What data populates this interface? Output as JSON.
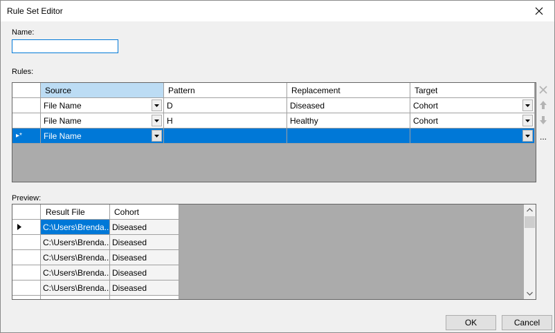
{
  "window": {
    "title": "Rule Set Editor"
  },
  "name": {
    "label": "Name:",
    "value": ""
  },
  "rules": {
    "label": "Rules:",
    "columns": [
      "Source",
      "Pattern",
      "Replacement",
      "Target"
    ],
    "rows": [
      {
        "source": "File Name",
        "pattern": "D",
        "replacement": "Diseased",
        "target": "Cohort"
      },
      {
        "source": "File Name",
        "pattern": "H",
        "replacement": "Healthy",
        "target": "Cohort"
      },
      {
        "source": "File Name",
        "pattern": "",
        "replacement": "",
        "target": "",
        "row_header": "▸*"
      }
    ],
    "side_buttons": {
      "more_label": "..."
    }
  },
  "preview": {
    "label": "Preview:",
    "columns": [
      "Result File",
      "Cohort"
    ],
    "rows": [
      {
        "file": "C:\\Users\\Brenda...",
        "cohort": "Diseased"
      },
      {
        "file": "C:\\Users\\Brenda...",
        "cohort": "Diseased"
      },
      {
        "file": "C:\\Users\\Brenda...",
        "cohort": "Diseased"
      },
      {
        "file": "C:\\Users\\Brenda...",
        "cohort": "Diseased"
      },
      {
        "file": "C:\\Users\\Brenda...",
        "cohort": "Diseased"
      }
    ]
  },
  "buttons": {
    "ok": "OK",
    "cancel": "Cancel"
  },
  "colors": {
    "selection": "#0078d7",
    "header_selected": "#bcdcf4",
    "grid_background": "#ababab"
  }
}
